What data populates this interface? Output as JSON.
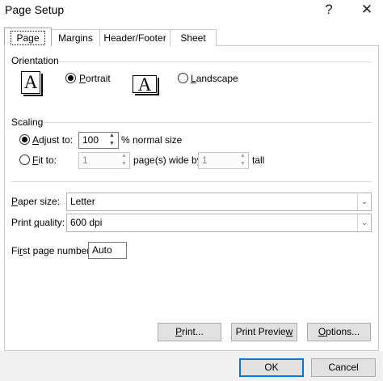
{
  "window": {
    "title": "Page Setup",
    "help_label": "?",
    "close_label": "✕"
  },
  "tabs": [
    {
      "label": "Page"
    },
    {
      "label": "Margins"
    },
    {
      "label": "Header/Footer"
    },
    {
      "label": "Sheet"
    }
  ],
  "orientation": {
    "label": "Orientation",
    "portrait_label": "Portrait",
    "landscape_label": "Landscape",
    "portrait_icon": "A",
    "landscape_icon": "A",
    "selected": "Portrait"
  },
  "scaling": {
    "label": "Scaling",
    "adjust_to_label": "Adjust to:",
    "adjust_value": "100",
    "normal_size_label": "% normal size",
    "fit_to_label": "Fit to:",
    "fit_wide_value": "1",
    "pages_wide_label": "page(s) wide by",
    "fit_tall_value": "1",
    "tall_label": "tall",
    "selected": "Adjust to"
  },
  "paper": {
    "paper_size_label": "Paper size:",
    "paper_size_value": "Letter",
    "print_quality_label": "Print quality:",
    "print_quality_value": "600 dpi",
    "first_page_label": "First page number:",
    "first_page_value": "Auto"
  },
  "actions": {
    "print_label": "Print...",
    "preview_label": "Print Preview",
    "options_label": "Options..."
  },
  "footer": {
    "ok_label": "OK",
    "cancel_label": "Cancel"
  },
  "colors": {
    "accent": "#0078d7",
    "button_face": "#e1e1e1",
    "footer_bg": "#f0f0f0"
  }
}
